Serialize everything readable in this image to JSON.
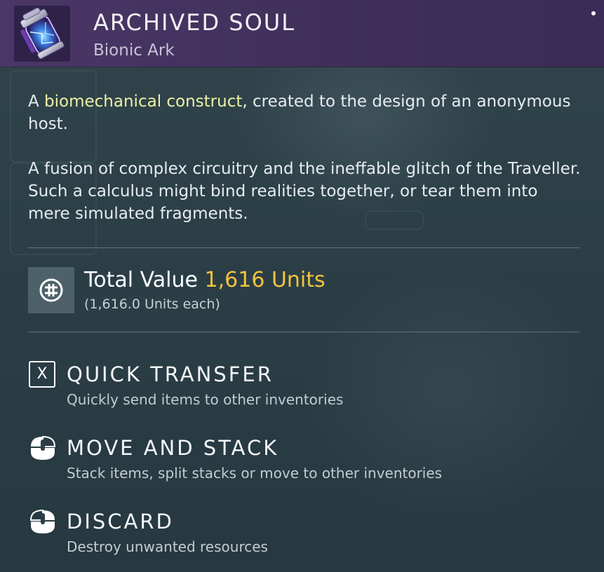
{
  "item": {
    "title": "ARCHIVED SOUL",
    "subtitle": "Bionic Ark",
    "icon": "archived-soul-jar-icon"
  },
  "description": {
    "p1_prefix": "A ",
    "p1_highlight": "biomechanical construct",
    "p1_suffix": ", created to the design of an anonymous host.",
    "p2": "A fusion of complex circuitry and the ineffable glitch of the Traveller. Such a calculus might bind realities together, or tear them into mere simulated fragments."
  },
  "value": {
    "label": "Total Value",
    "amount": "1,616 Units",
    "each": "(1,616.0 Units each)",
    "icon": "units-currency-icon"
  },
  "actions": [
    {
      "title": "QUICK TRANSFER",
      "desc": "Quickly send items to other inventories",
      "key": "X",
      "icon": "x-key-icon"
    },
    {
      "title": "MOVE AND STACK",
      "desc": "Stack items, split stacks or move to other inventories",
      "icon": "mouse-left-click-icon"
    },
    {
      "title": "DISCARD",
      "desc": "Destroy unwanted resources",
      "icon": "mouse-right-click-icon"
    }
  ],
  "colors": {
    "header_bg": "#45335f",
    "panel_bg": "#2c3f47",
    "highlight_text": "#eef0a5",
    "units_gold": "#f4c33b"
  }
}
